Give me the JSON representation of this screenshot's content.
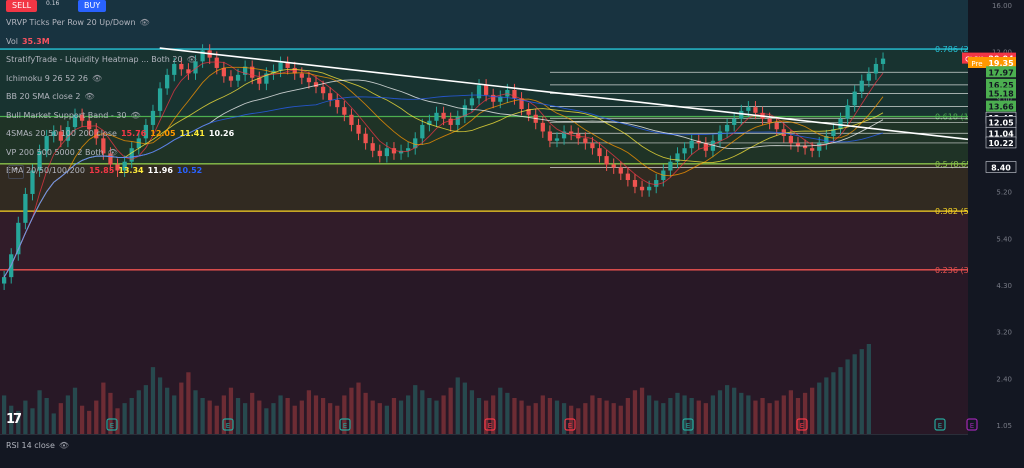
{
  "header": {
    "sell_label": "SELL",
    "buy_label": "BUY",
    "spread": "0.16"
  },
  "legend": [
    {
      "id": "vrvp",
      "label": "VRVP Ticks Per Row 20 Up/Down",
      "values": [],
      "eye": true
    },
    {
      "id": "vol",
      "label": "Vol",
      "values": [
        {
          "v": "35.3M",
          "color": "#f7525f"
        }
      ],
      "eye": false
    },
    {
      "id": "stratify",
      "label": "StratifyTrade - Liquidity Heatmap ... Both 20",
      "values": [],
      "eye": true
    },
    {
      "id": "ichimoku",
      "label": "Ichimoku 9 26 52 26",
      "values": [],
      "eye": true
    },
    {
      "id": "bb",
      "label": "BB 20 SMA close 2",
      "values": [],
      "eye": true
    },
    {
      "id": "bmsb",
      "label": "Bull Market Support Band - 30",
      "values": [],
      "eye": true
    },
    {
      "id": "smas",
      "label": "4SMAs 20 50 100 200 close",
      "values": [
        {
          "v": "15.76",
          "color": "#f23645"
        },
        {
          "v": "12.05",
          "color": "#ff9800"
        },
        {
          "v": "11.41",
          "color": "#ffeb3b"
        },
        {
          "v": "10.26",
          "color": "#ffffff"
        }
      ],
      "eye": false
    },
    {
      "id": "vp",
      "label": "VP 200 500 5000 2 Both",
      "values": [],
      "eye": true
    },
    {
      "id": "ema",
      "label": "EMA 20/50/100/200",
      "values": [
        {
          "v": "15.85",
          "color": "#f23645"
        },
        {
          "v": "13.34",
          "color": "#ffeb3b"
        },
        {
          "v": "11.96",
          "color": "#ffffff"
        },
        {
          "v": "10.52",
          "color": "#2962ff"
        }
      ],
      "eye": false
    }
  ],
  "collapse_icon": "chevron-up-icon",
  "rsi_label": "RSI 14 close",
  "logo_text": "17",
  "chart_data": {
    "type": "candlestick",
    "symbol": "CLSK",
    "ylim": [
      1.0,
      32.0
    ],
    "log_scale": true,
    "y_ticks": [
      "16.00",
      "12.00",
      "9.00",
      "7.00",
      "5.20",
      "5.40",
      "4.30",
      "3.20",
      "2.40",
      "1.05"
    ],
    "fib_levels": [
      {
        "label": "0.786 (21.63)",
        "value": 21.63,
        "color": "#26c6da"
      },
      {
        "label": "0.618 (12.62)",
        "value": 12.62,
        "color": "#4caf50"
      },
      {
        "label": "0.5 (8.65)",
        "value": 8.65,
        "color": "#8bc34a"
      },
      {
        "label": "0.382 (5.93)",
        "value": 5.93,
        "color": "#f9d423"
      },
      {
        "label": "0.236 (3.71)",
        "value": 3.71,
        "color": "#ef5350"
      }
    ],
    "price_labels": [
      {
        "label": "CLSK",
        "value": 20.04,
        "color": "#f23645",
        "text": "20.04"
      },
      {
        "label": "Pre",
        "value": 19.35,
        "color": "#ff9800",
        "text": "19.35"
      },
      {
        "label": "",
        "value": 17.97,
        "color": "#4caf50",
        "text": "17.97"
      },
      {
        "label": "",
        "value": 16.25,
        "color": "#4caf50",
        "text": "16.25"
      },
      {
        "label": "",
        "value": 15.18,
        "color": "#4caf50",
        "text": "15.18"
      },
      {
        "label": "",
        "value": 13.66,
        "color": "#4caf50",
        "text": "13.66"
      },
      {
        "label": "",
        "value": 12.45,
        "color": "#131722",
        "text": "12.45"
      },
      {
        "label": "",
        "value": 12.05,
        "color": "#131722",
        "text": "12.05"
      },
      {
        "label": "",
        "value": 11.04,
        "color": "#131722",
        "text": "11.04"
      },
      {
        "label": "",
        "value": 10.22,
        "color": "#131722",
        "text": "10.22"
      },
      {
        "label": "",
        "value": 8.4,
        "color": "#131722",
        "text": "8.40"
      }
    ],
    "closes": [
      3.5,
      4.2,
      5.4,
      6.8,
      8.2,
      9.6,
      10.8,
      11.2,
      10.4,
      11.6,
      12.8,
      12.2,
      11.4,
      10.6,
      9.4,
      8.6,
      8.2,
      8.8,
      9.8,
      10.6,
      11.8,
      13.2,
      15.8,
      17.6,
      19.2,
      18.4,
      17.8,
      19.6,
      21.4,
      20.2,
      18.6,
      17.4,
      16.8,
      17.6,
      18.8,
      17.2,
      16.4,
      17.8,
      18.2,
      19.4,
      18.6,
      17.8,
      17.2,
      16.6,
      16.0,
      15.2,
      14.4,
      13.6,
      12.8,
      11.8,
      11.0,
      10.2,
      9.6,
      9.2,
      9.8,
      9.4,
      9.6,
      9.8,
      10.6,
      11.8,
      12.2,
      13.0,
      12.4,
      11.8,
      12.6,
      13.8,
      14.6,
      16.2,
      15.0,
      14.2,
      14.8,
      15.6,
      14.6,
      13.4,
      12.8,
      12.0,
      11.2,
      10.4,
      10.6,
      11.2,
      11.0,
      10.6,
      10.2,
      9.8,
      9.2,
      8.6,
      8.4,
      8.0,
      7.6,
      7.2,
      7.0,
      7.2,
      7.6,
      8.2,
      8.8,
      9.4,
      9.8,
      10.4,
      10.2,
      9.6,
      10.4,
      11.2,
      11.8,
      12.4,
      13.2,
      13.6,
      13.0,
      12.4,
      12.0,
      11.4,
      10.8,
      10.2,
      10.0,
      9.8,
      9.6,
      10.2,
      10.8,
      11.4,
      12.4,
      13.8,
      15.4,
      16.8,
      17.8,
      19.2,
      20.04
    ],
    "volumes": [
      30,
      22,
      18,
      26,
      20,
      34,
      28,
      16,
      24,
      30,
      36,
      22,
      18,
      26,
      40,
      32,
      20,
      24,
      28,
      34,
      38,
      52,
      44,
      36,
      30,
      40,
      48,
      34,
      28,
      26,
      22,
      30,
      36,
      28,
      24,
      32,
      26,
      20,
      24,
      30,
      28,
      22,
      26,
      34,
      30,
      28,
      24,
      22,
      30,
      36,
      40,
      32,
      26,
      24,
      22,
      28,
      26,
      30,
      38,
      34,
      28,
      26,
      30,
      36,
      44,
      40,
      34,
      28,
      26,
      30,
      36,
      32,
      28,
      26,
      22,
      24,
      30,
      28,
      26,
      24,
      22,
      20,
      24,
      30,
      28,
      26,
      24,
      22,
      28,
      34,
      36,
      30,
      26,
      24,
      28,
      32,
      30,
      28,
      26,
      24,
      30,
      34,
      38,
      36,
      32,
      30,
      26,
      28,
      24,
      26,
      30,
      34,
      28,
      32,
      36,
      40,
      44,
      48,
      52,
      58,
      62,
      66,
      70
    ],
    "trendline": {
      "from": [
        0.165,
        21.8
      ],
      "to": [
        1.0,
        10.0
      ]
    },
    "earnings_markers": [
      {
        "type": "E",
        "color": "#26a69a"
      },
      {
        "type": "E",
        "color": "#26a69a"
      },
      {
        "type": "E",
        "color": "#26a69a"
      },
      {
        "type": "E",
        "color": "#f23645"
      },
      {
        "type": "E",
        "color": "#f23645"
      },
      {
        "type": "E",
        "color": "#26a69a"
      },
      {
        "type": "E",
        "color": "#f23645"
      },
      {
        "type": "E",
        "color": "#26a69a"
      },
      {
        "type": "E",
        "color": "#9c27b0"
      }
    ],
    "grid": false
  }
}
